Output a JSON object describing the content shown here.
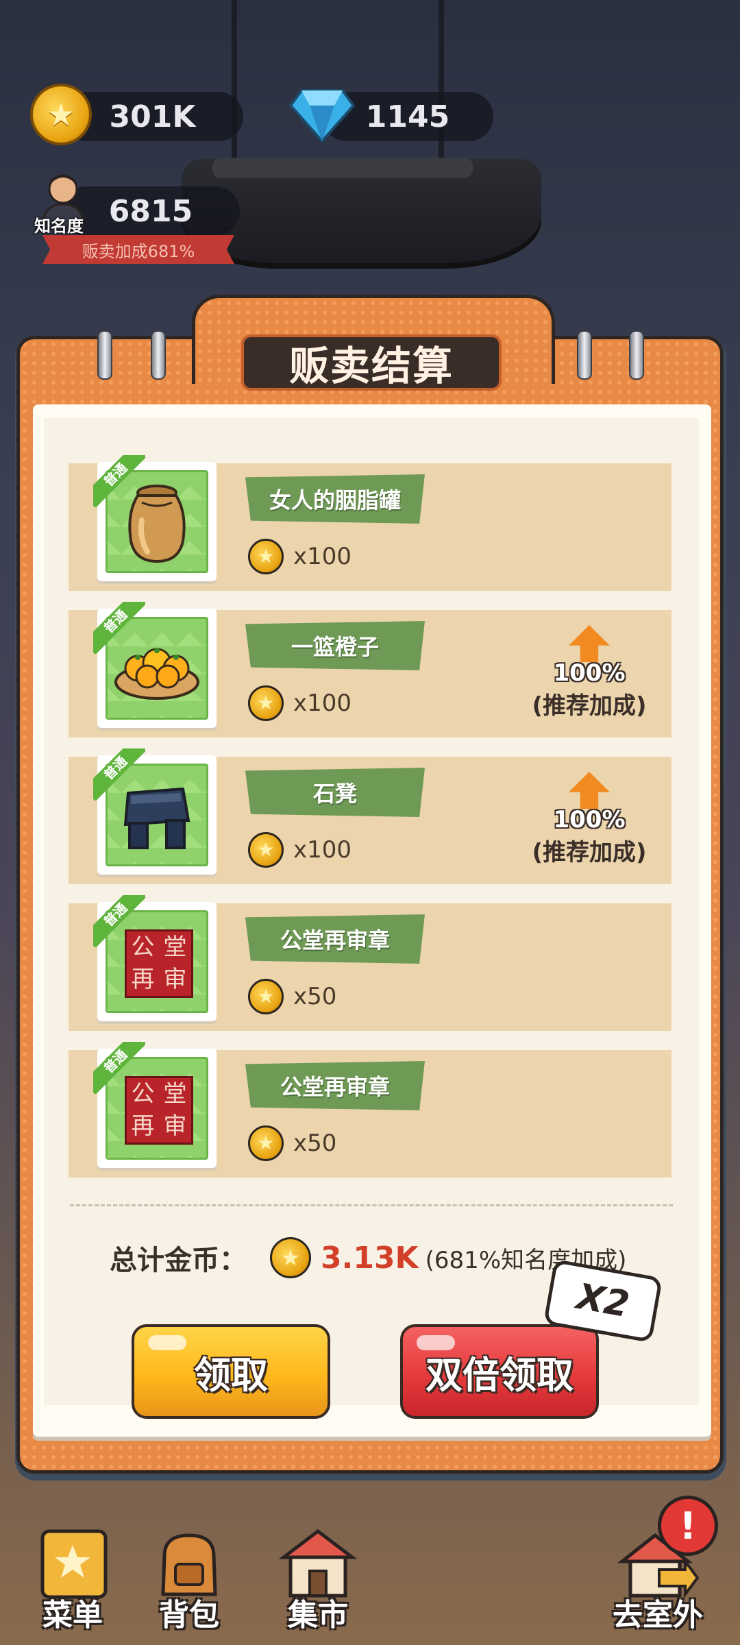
{
  "header": {
    "coins": "301K",
    "gems": "1145",
    "fame_value": "6815",
    "fame_label": "知名度",
    "sell_bonus": "贩卖加成681%"
  },
  "panel": {
    "title": "贩卖结算"
  },
  "items": [
    {
      "badge": "普通",
      "name": "女人的胭脂罐",
      "price": "x100",
      "icon": "jar-icon"
    },
    {
      "badge": "普通",
      "name": "一篮橙子",
      "price": "x100",
      "icon": "orange-basket-icon",
      "bonus_pct": "100%",
      "bonus_text": "(推荐加成)"
    },
    {
      "badge": "普通",
      "name": "石凳",
      "price": "x100",
      "icon": "stone-stool-icon",
      "bonus_pct": "100%",
      "bonus_text": "(推荐加成)"
    },
    {
      "badge": "普通",
      "name": "公堂再审章",
      "price": "x50",
      "icon": "seal-icon",
      "seal_chars": [
        "公",
        "堂",
        "再",
        "审"
      ]
    },
    {
      "badge": "普通",
      "name": "公堂再审章",
      "price": "x50",
      "icon": "seal-icon",
      "seal_chars": [
        "公",
        "堂",
        "再",
        "审"
      ]
    }
  ],
  "total": {
    "label": "总计金币：",
    "amount": "3.13K",
    "note": "(681%知名度加成)"
  },
  "buttons": {
    "collect": "领取",
    "double_collect": "双倍领取",
    "x2_tag": "X2"
  },
  "nav": {
    "menu": "菜单",
    "bag": "背包",
    "market": "集市",
    "outdoor": "去室外",
    "alert": "!"
  },
  "colors": {
    "panel_orange": "#e88a45",
    "row_tan": "#ecd5ad",
    "name_tag_green": "#6f9a56",
    "total_red": "#d2402a",
    "button_yellow": "#ffb81c",
    "button_red": "#e63a3c"
  }
}
